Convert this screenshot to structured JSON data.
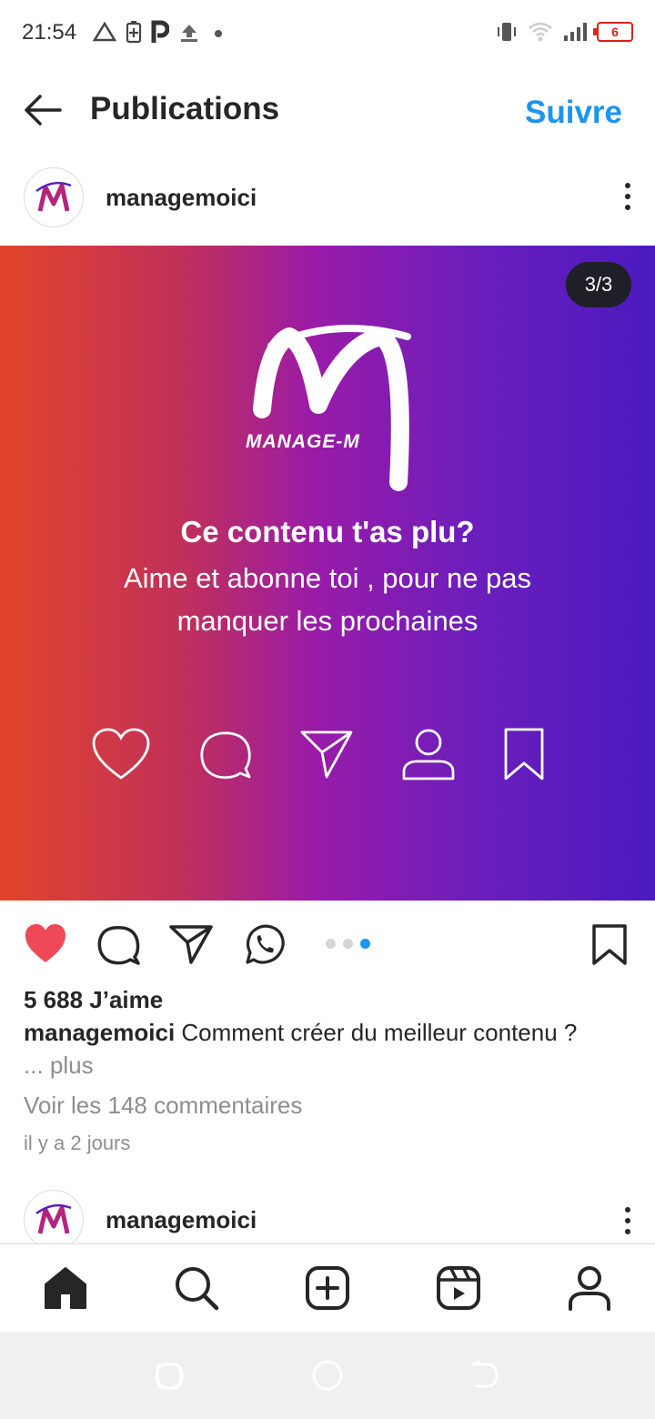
{
  "status_bar": {
    "time": "21:54",
    "battery_level": "6",
    "icons": [
      "alert-triangle-icon",
      "battery-saver-icon",
      "parking-icon",
      "upload-icon",
      "dot-icon",
      "vibrate-icon",
      "wifi-icon",
      "signal-icon",
      "battery-icon"
    ]
  },
  "header": {
    "title": "Publications",
    "follow_label": "Suivre"
  },
  "post": {
    "username": "managemoici",
    "counter": "3/3",
    "image": {
      "brand_name": "MANAGE-M",
      "heading": "Ce contenu t'as plu?",
      "body": "Aime et abonne toi , pour ne pas manquer les prochaines",
      "icons": [
        "heart-icon",
        "comment-icon",
        "send-icon",
        "user-icon",
        "bookmark-icon"
      ]
    },
    "likes": "5 688 J’aime",
    "caption_user": "managemoici",
    "caption_text": " Comment créer du meilleur contenu ?",
    "more": "... plus",
    "comments_link": "Voir les 148 commentaires",
    "time_ago": "il y a 2 jours",
    "carousel_index": 3,
    "carousel_total": 3,
    "liked": true
  },
  "next_post": {
    "username": "managemoici"
  },
  "colors": {
    "accent": "#1b95f0",
    "like": "#ed4956",
    "text": "#262626",
    "muted": "#8e8e8e"
  }
}
